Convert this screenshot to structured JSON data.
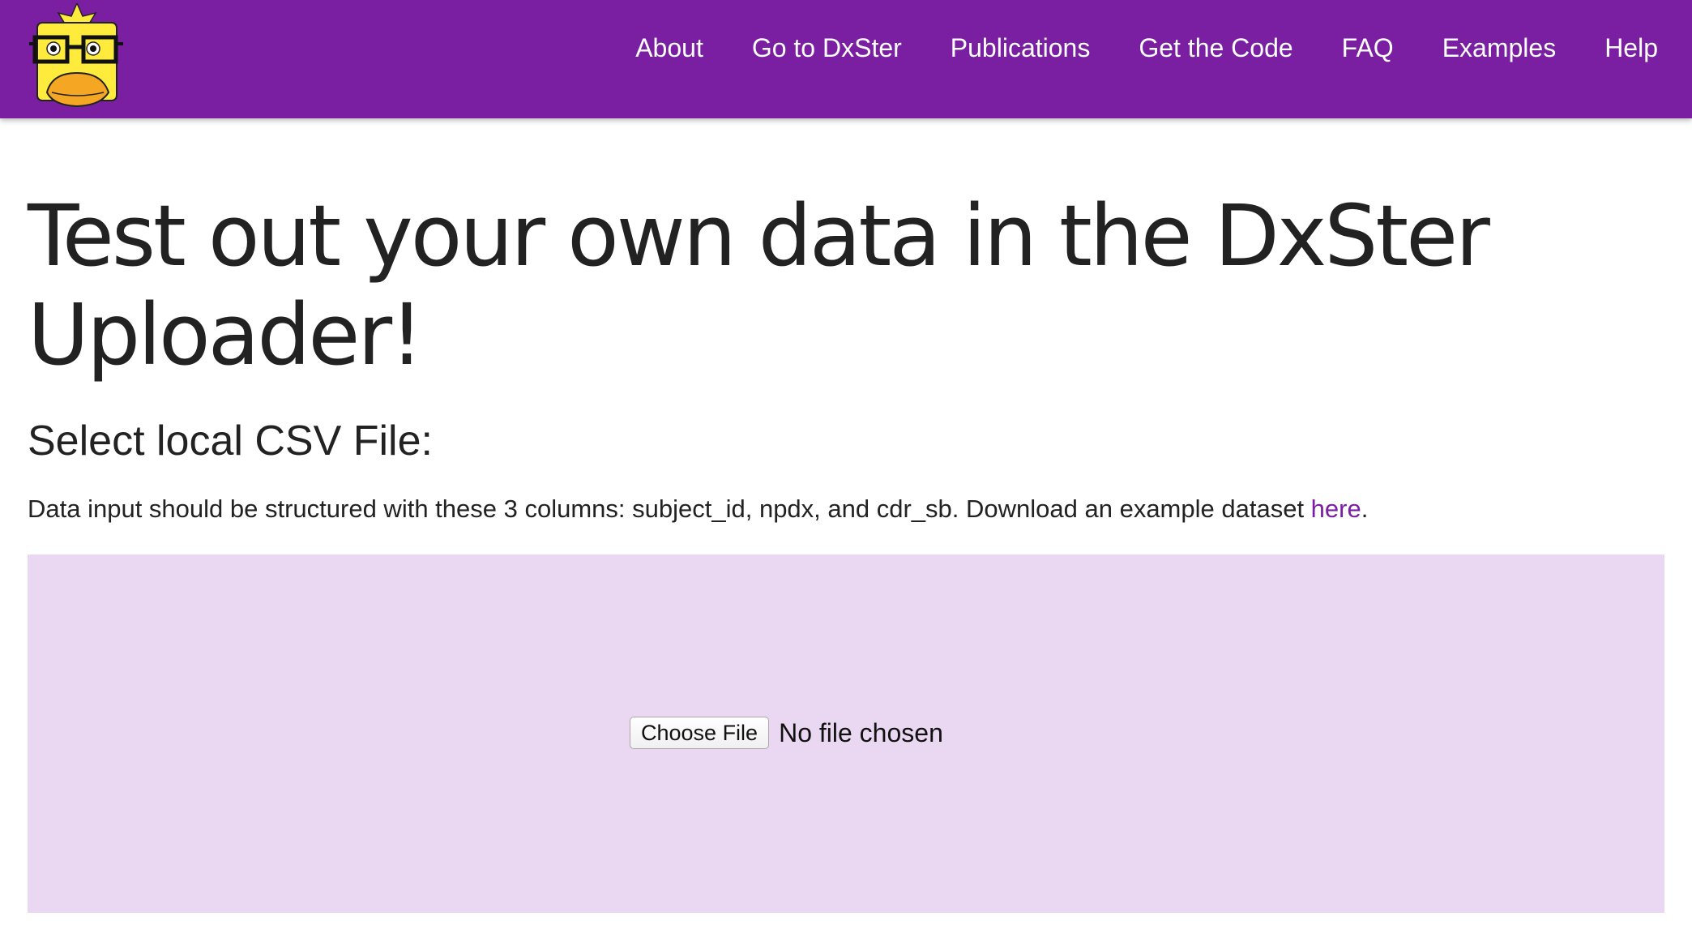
{
  "navbar": {
    "logo": {
      "icon": "duck-with-glasses-logo-icon"
    },
    "links": [
      {
        "label": "About"
      },
      {
        "label": "Go to DxSter"
      },
      {
        "label": "Publications"
      },
      {
        "label": "Get the Code"
      },
      {
        "label": "FAQ"
      },
      {
        "label": "Examples"
      },
      {
        "label": "Help"
      }
    ]
  },
  "main": {
    "title": "Test out your own data in the DxSter Uploader!",
    "section_heading": "Select local CSV File:",
    "description_prefix": "Data input should be structured with these 3 columns: subject_id, npdx, and cdr_sb. Download an example dataset ",
    "description_link": "here",
    "description_suffix": "."
  },
  "uploader": {
    "button_label": "Choose File",
    "status_text": "No file chosen"
  },
  "colors": {
    "brand_purple": "#7b1fa2",
    "drop_zone_background": "#ead8f2",
    "logo_yellow": "#ffeb3b",
    "beak_orange": "#f5a623"
  }
}
